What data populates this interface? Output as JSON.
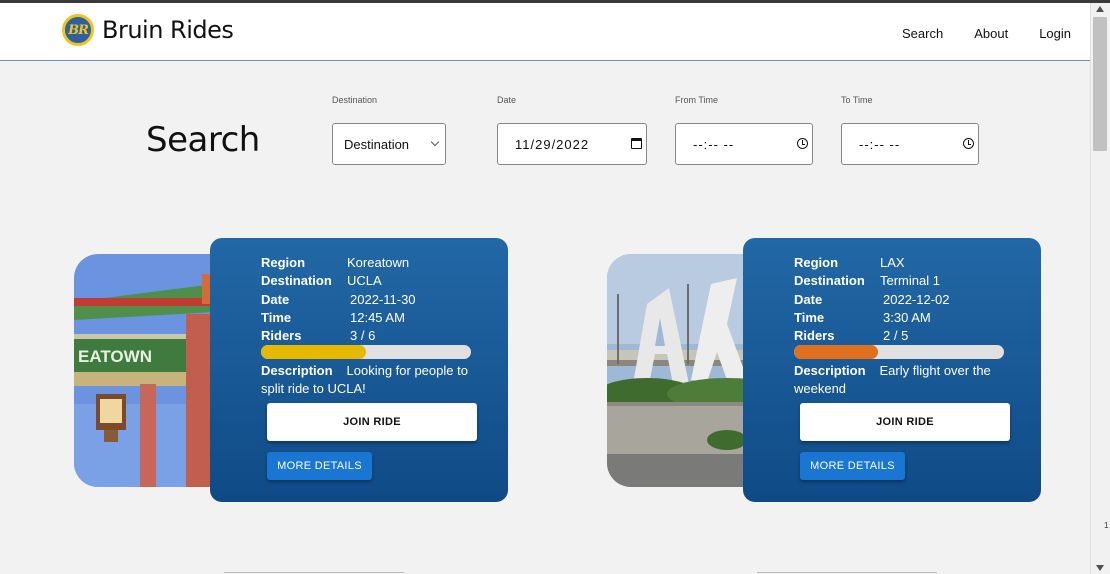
{
  "app": {
    "logo_text": "BR",
    "name": "Bruin Rides"
  },
  "nav": {
    "items": [
      {
        "label": "Search"
      },
      {
        "label": "About"
      },
      {
        "label": "Login"
      }
    ]
  },
  "search": {
    "heading": "Search",
    "destination": {
      "label": "Destination",
      "value": "Destination"
    },
    "date": {
      "label": "Date",
      "value": "11/29/2022"
    },
    "from_time": {
      "label": "From Time",
      "value": "--:-- --"
    },
    "to_time": {
      "label": "To Time",
      "value": "--:-- --"
    }
  },
  "rides": [
    {
      "photo": "koreatown-sign-image",
      "region_label": "Region",
      "region": "Koreatown",
      "destination_label": "Destination",
      "destination": "UCLA",
      "date_label": "Date",
      "date": "2022-11-30",
      "time_label": "Time",
      "time": "12:45 AM",
      "riders_label": "Riders",
      "riders": "3 / 6",
      "riders_fraction": 0.5,
      "bar_color": "#e6b800",
      "description_label": "Description",
      "description": "Looking for people to split ride to UCLA!",
      "join_label": "JOIN RIDE",
      "details_label": "MORE DETAILS"
    },
    {
      "photo": "lax-sign-image",
      "region_label": "Region",
      "region": "LAX",
      "destination_label": "Destination",
      "destination": "Terminal 1",
      "date_label": "Date",
      "date": "2022-12-02",
      "time_label": "Time",
      "time": "3:30 AM",
      "riders_label": "Riders",
      "riders": "2 / 5",
      "riders_fraction": 0.4,
      "bar_color": "#e0701d",
      "description_label": "Description",
      "description": "Early flight over the weekend",
      "join_label": "JOIN RIDE",
      "details_label": "MORE DETAILS"
    }
  ],
  "scrollbar": {
    "marker": "1"
  },
  "colors": {
    "card_top": "#2268a6",
    "card_bottom": "#0f4a86",
    "more_button": "#1976d2",
    "logo_ring": "#f0c419",
    "logo_fill": "#2f5fa3"
  }
}
